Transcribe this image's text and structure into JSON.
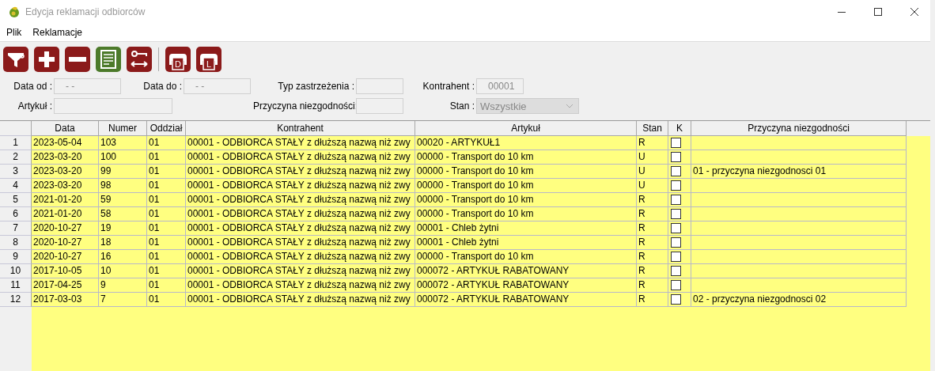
{
  "window": {
    "title": "Edycja reklamacji odbiorców"
  },
  "menu": [
    {
      "label": "Plik"
    },
    {
      "label": "Reklamacje"
    }
  ],
  "toolbar": [
    {
      "kind": "filter"
    },
    {
      "kind": "add"
    },
    {
      "kind": "remove"
    },
    {
      "kind": "document"
    },
    {
      "kind": "swap"
    },
    {
      "kind": "separator"
    },
    {
      "kind": "print",
      "letter": "D"
    },
    {
      "kind": "print",
      "letter": "L"
    }
  ],
  "filters": [
    {
      "label": "Data od :",
      "value": "- -"
    },
    {
      "label": "Data do :",
      "value": "- -"
    },
    {
      "label": "Typ zastrzeżenia :"
    },
    {
      "label": "Kontrahent :",
      "value": "00001"
    },
    {
      "label": "Artykuł :"
    },
    {
      "label": "Przyczyna niezgodności:"
    },
    {
      "label": "Stan :",
      "value": "Wszystkie",
      "kind": "select"
    }
  ],
  "table": {
    "columns": [
      "Data",
      "Numer",
      "Oddział",
      "Kontrahent",
      "Artykuł",
      "Stan",
      "K",
      "Przyczyna niezgodności"
    ],
    "rows": [
      {
        "row": "1",
        "data": "2023-05-04",
        "numer": "103",
        "oddzial": "01",
        "kontrahent": "00001 - ODBIORCA STAŁY z dłuższą nazwą niż zwy",
        "artykul": "00020 - ARTYKUŁ1",
        "stan": "R",
        "checked": false
      },
      {
        "row": "2",
        "data": "2023-03-20",
        "numer": "100",
        "oddzial": "01",
        "kontrahent": "00001 - ODBIORCA STAŁY z dłuższą nazwą niż zwy",
        "artykul": "00000 - Transport do 10 km",
        "stan": "U",
        "checked": false
      },
      {
        "row": "3",
        "data": "2023-03-20",
        "numer": "99",
        "oddzial": "01",
        "kontrahent": "00001 - ODBIORCA STAŁY z dłuższą nazwą niż zwy",
        "artykul": "00000 - Transport do 10 km",
        "stan": "U",
        "checked": false,
        "przyczyna": "01 - przyczyna niezgodnosci 01"
      },
      {
        "row": "4",
        "data": "2023-03-20",
        "numer": "98",
        "oddzial": "01",
        "kontrahent": "00001 - ODBIORCA STAŁY z dłuższą nazwą niż zwy",
        "artykul": "00000 - Transport do 10 km",
        "stan": "U",
        "checked": false
      },
      {
        "row": "5",
        "data": "2021-01-20",
        "numer": "59",
        "oddzial": "01",
        "kontrahent": "00001 - ODBIORCA STAŁY z dłuższą nazwą niż zwy",
        "artykul": "00000 - Transport do 10 km",
        "stan": "R",
        "checked": false
      },
      {
        "row": "6",
        "data": "2021-01-20",
        "numer": "58",
        "oddzial": "01",
        "kontrahent": "00001 - ODBIORCA STAŁY z dłuższą nazwą niż zwy",
        "artykul": "00000 - Transport do 10 km",
        "stan": "R",
        "checked": false
      },
      {
        "row": "7",
        "data": "2020-10-27",
        "numer": "19",
        "oddzial": "01",
        "kontrahent": "00001 - ODBIORCA STAŁY z dłuższą nazwą niż zwy",
        "artykul": "00001 - Chleb żytni",
        "stan": "R",
        "checked": false
      },
      {
        "row": "8",
        "data": "2020-10-27",
        "numer": "18",
        "oddzial": "01",
        "kontrahent": "00001 - ODBIORCA STAŁY z dłuższą nazwą niż zwy",
        "artykul": "00001 - Chleb żytni",
        "stan": "R",
        "checked": false
      },
      {
        "row": "9",
        "data": "2020-10-27",
        "numer": "16",
        "oddzial": "01",
        "kontrahent": "00001 - ODBIORCA STAŁY z dłuższą nazwą niż zwy",
        "artykul": "00000 - Transport do 10 km",
        "stan": "R",
        "checked": false
      },
      {
        "row": "10",
        "data": "2017-10-05",
        "numer": "10",
        "oddzial": "01",
        "kontrahent": "00001 - ODBIORCA STAŁY z dłuższą nazwą niż zwy",
        "artykul": "000072 - ARTYKUŁ RABATOWANY",
        "stan": "R",
        "checked": false
      },
      {
        "row": "11",
        "data": "2017-04-25",
        "numer": "9",
        "oddzial": "01",
        "kontrahent": "00001 - ODBIORCA STAŁY z dłuższą nazwą niż zwy",
        "artykul": "000072 - ARTYKUŁ RABATOWANY",
        "stan": "R",
        "checked": false
      },
      {
        "row": "12",
        "data": "2017-03-03",
        "numer": "7",
        "oddzial": "01",
        "kontrahent": "00001 - ODBIORCA STAŁY z dłuższą nazwą niż zwy",
        "artykul": "000072 - ARTYKUŁ RABATOWANY",
        "stan": "R",
        "checked": false,
        "przyczyna": "02 - przyczyna niezgodnosci 02"
      }
    ]
  }
}
